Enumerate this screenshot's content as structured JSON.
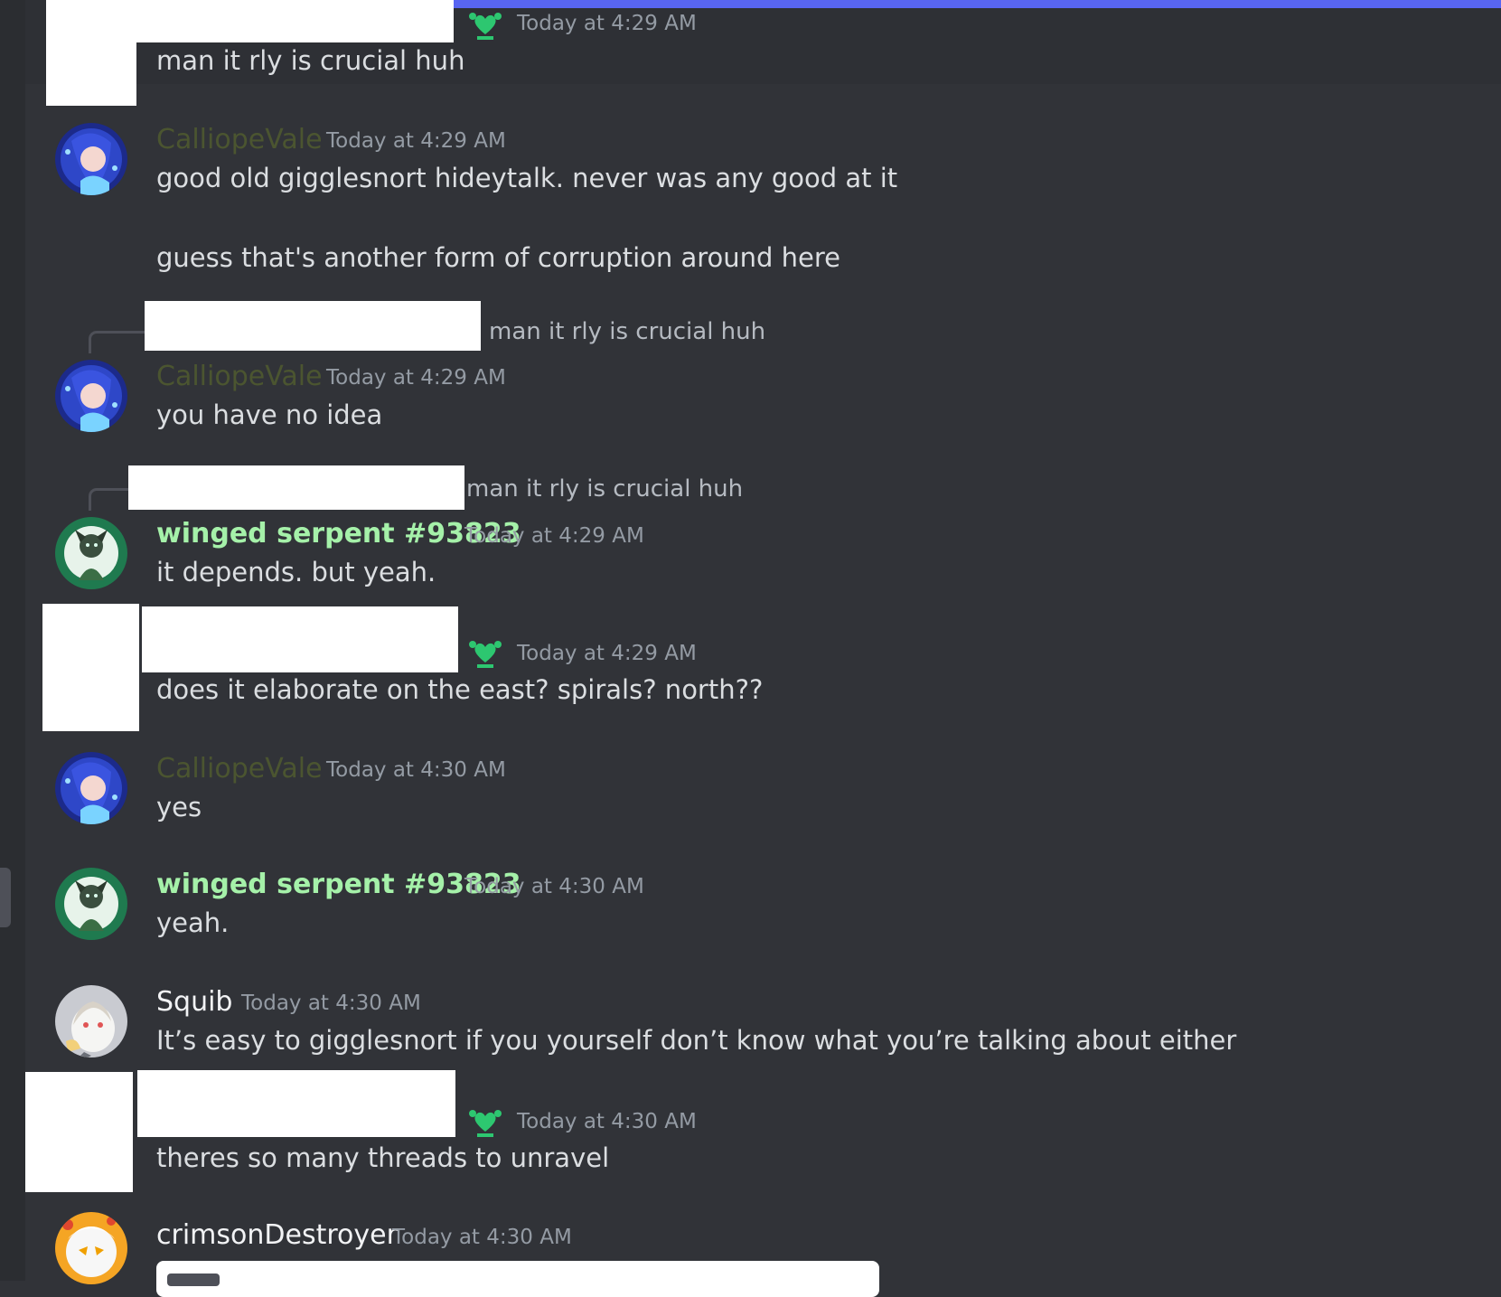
{
  "theme": {
    "background": "#313338",
    "accent": "#5865f2",
    "timestamp_color": "#949ba4"
  },
  "messages": [
    {
      "author": "",
      "timestamp": "Today at 4:29 AM",
      "lines": [
        "man it rly is crucial huh"
      ]
    },
    {
      "author": "CalliopeVale",
      "name_color": "#4b5530",
      "timestamp": "Today at 4:29 AM",
      "lines": [
        "good old gigglesnort hideytalk. never was any good at it",
        "guess that's another form of corruption around here"
      ]
    },
    {
      "reply_preview": "man it rly is crucial huh",
      "author": "CalliopeVale",
      "name_color": "#4b5530",
      "timestamp": "Today at 4:29 AM",
      "lines": [
        "you have no idea"
      ]
    },
    {
      "reply_preview": "man it rly is crucial huh",
      "author": "winged serpent #93823",
      "name_color": "#a5f1a9",
      "timestamp": "Today at 4:29 AM",
      "lines": [
        "it depends. but yeah."
      ]
    },
    {
      "author": "",
      "timestamp": "Today at 4:29 AM",
      "lines": [
        "does it elaborate on the east? spirals? north??"
      ]
    },
    {
      "author": "CalliopeVale",
      "name_color": "#4b5530",
      "timestamp": "Today at 4:30 AM",
      "lines": [
        "yes"
      ]
    },
    {
      "author": "winged serpent #93823",
      "name_color": "#a5f1a9",
      "timestamp": "Today at 4:30 AM",
      "lines": [
        "yeah."
      ]
    },
    {
      "author": "Squib",
      "name_color": "#f2f3f5",
      "timestamp": "Today at 4:30 AM",
      "lines": [
        "It’s easy to gigglesnort if you yourself don’t know what you’re talking about either"
      ]
    },
    {
      "author": "",
      "timestamp": "Today at 4:30 AM",
      "lines": [
        "theres so many threads to unravel"
      ]
    },
    {
      "author": "crimsonDestroyer",
      "name_color": "#f2f3f5",
      "timestamp": "Today at 4:30 AM",
      "lines": []
    }
  ]
}
